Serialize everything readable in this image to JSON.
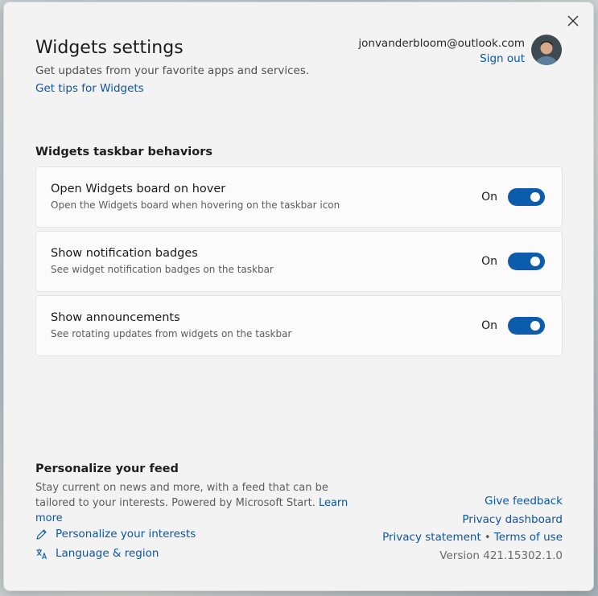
{
  "header": {
    "title": "Widgets settings",
    "subtitle": "Get updates from your favorite apps and services.",
    "tips_link": "Get tips for Widgets"
  },
  "account": {
    "email": "jonvanderbloom@outlook.com",
    "sign_out": "Sign out"
  },
  "taskbar": {
    "section_title": "Widgets taskbar behaviors",
    "items": [
      {
        "title": "Open Widgets board on hover",
        "description": "Open the Widgets board when hovering on the taskbar icon",
        "state": "On"
      },
      {
        "title": "Show notification badges",
        "description": "See widget notification badges on the taskbar",
        "state": "On"
      },
      {
        "title": "Show announcements",
        "description": "See rotating updates from widgets on the taskbar",
        "state": "On"
      }
    ]
  },
  "feed": {
    "title": "Personalize your feed",
    "description": "Stay current on news and more, with a feed that can be tailored to your interests. Powered by Microsoft Start.",
    "learn_more": "Learn more",
    "interests": "Personalize your interests",
    "language": "Language & region"
  },
  "footer": {
    "give_feedback": "Give feedback",
    "privacy_dashboard": "Privacy dashboard",
    "privacy_statement": "Privacy statement",
    "separator": "•",
    "terms": "Terms of use",
    "version": "Version 421.15302.1.0"
  },
  "colors": {
    "accent": "#0b5cad",
    "link": "#0b56a5",
    "background": "#f3f3f3"
  }
}
